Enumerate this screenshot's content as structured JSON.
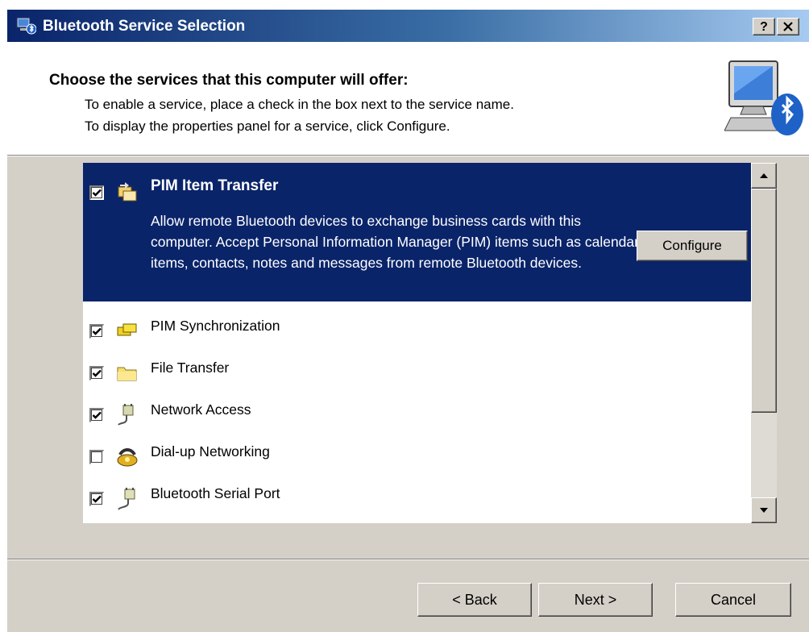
{
  "window": {
    "title": "Bluetooth Service Selection",
    "help_label": "?",
    "close_label": "✕"
  },
  "header": {
    "title": "Choose the services that this computer will offer:",
    "line1": "To enable a service, place a check in the box next to the service name.",
    "line2": "To display the properties panel for a service, click Configure."
  },
  "services": {
    "selected": {
      "label": "PIM Item Transfer",
      "checked": true,
      "icon": "pim-transfer-icon",
      "description": "Allow remote Bluetooth devices to exchange business cards with this computer. Accept Personal Information Manager (PIM) items such as calendar items, contacts, notes and messages from remote Bluetooth devices.",
      "configure_label": "Configure"
    },
    "items": [
      {
        "label": "PIM Synchronization",
        "checked": true,
        "icon": "sync-folder-icon"
      },
      {
        "label": "File Transfer",
        "checked": true,
        "icon": "folder-icon"
      },
      {
        "label": "Network Access",
        "checked": true,
        "icon": "network-plug-icon"
      },
      {
        "label": "Dial-up Networking",
        "checked": false,
        "icon": "phone-icon"
      },
      {
        "label": "Bluetooth Serial Port",
        "checked": true,
        "icon": "serial-plug-icon"
      }
    ]
  },
  "buttons": {
    "back_label": "< Back",
    "next_label": "Next >",
    "cancel_label": "Cancel"
  },
  "colors": {
    "selection": "#0a246a",
    "face": "#d4d0c8"
  }
}
